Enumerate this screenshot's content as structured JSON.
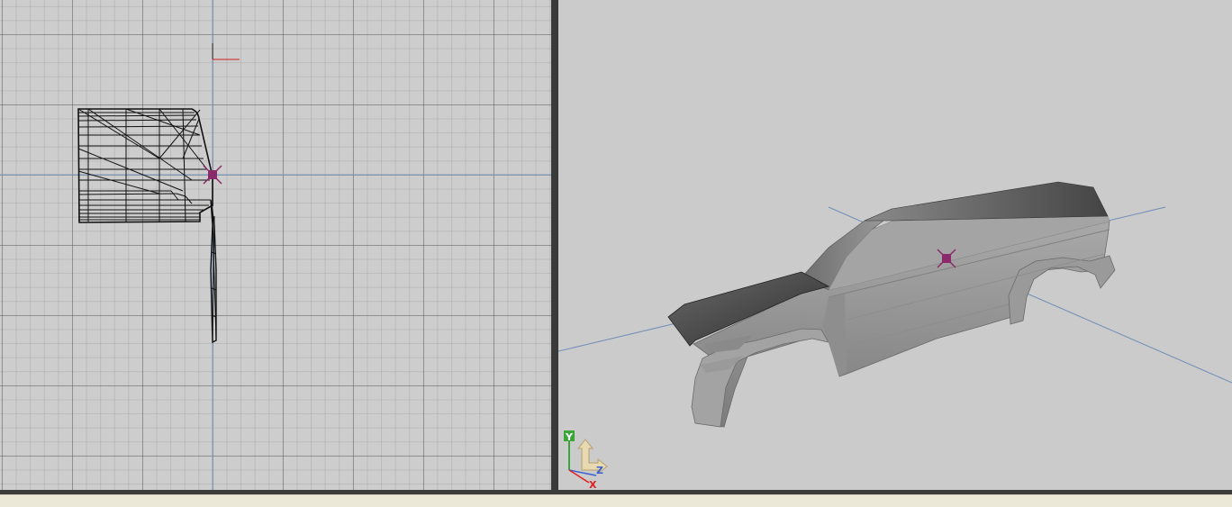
{
  "viewports": {
    "left": {
      "view": "orthographic-side",
      "mode": "wireframe"
    },
    "right": {
      "view": "perspective",
      "mode": "shaded"
    }
  },
  "axis_gizmo": {
    "labels": {
      "y": "Y",
      "z": "Z",
      "x": "X"
    },
    "colors": {
      "y": "#3aa63a",
      "z": "#3a5fd0",
      "x": "#e02020"
    }
  },
  "colors": {
    "grid_background": "#cdcdcd",
    "perspective_background": "#cbcbcb",
    "origin_lines": "#6f8fb8",
    "pivot_marker": "#8b2a6a",
    "status_bar": "#ece8d8"
  },
  "icons": [
    "pivot-marker-icon",
    "axis-gizmo-icon"
  ]
}
